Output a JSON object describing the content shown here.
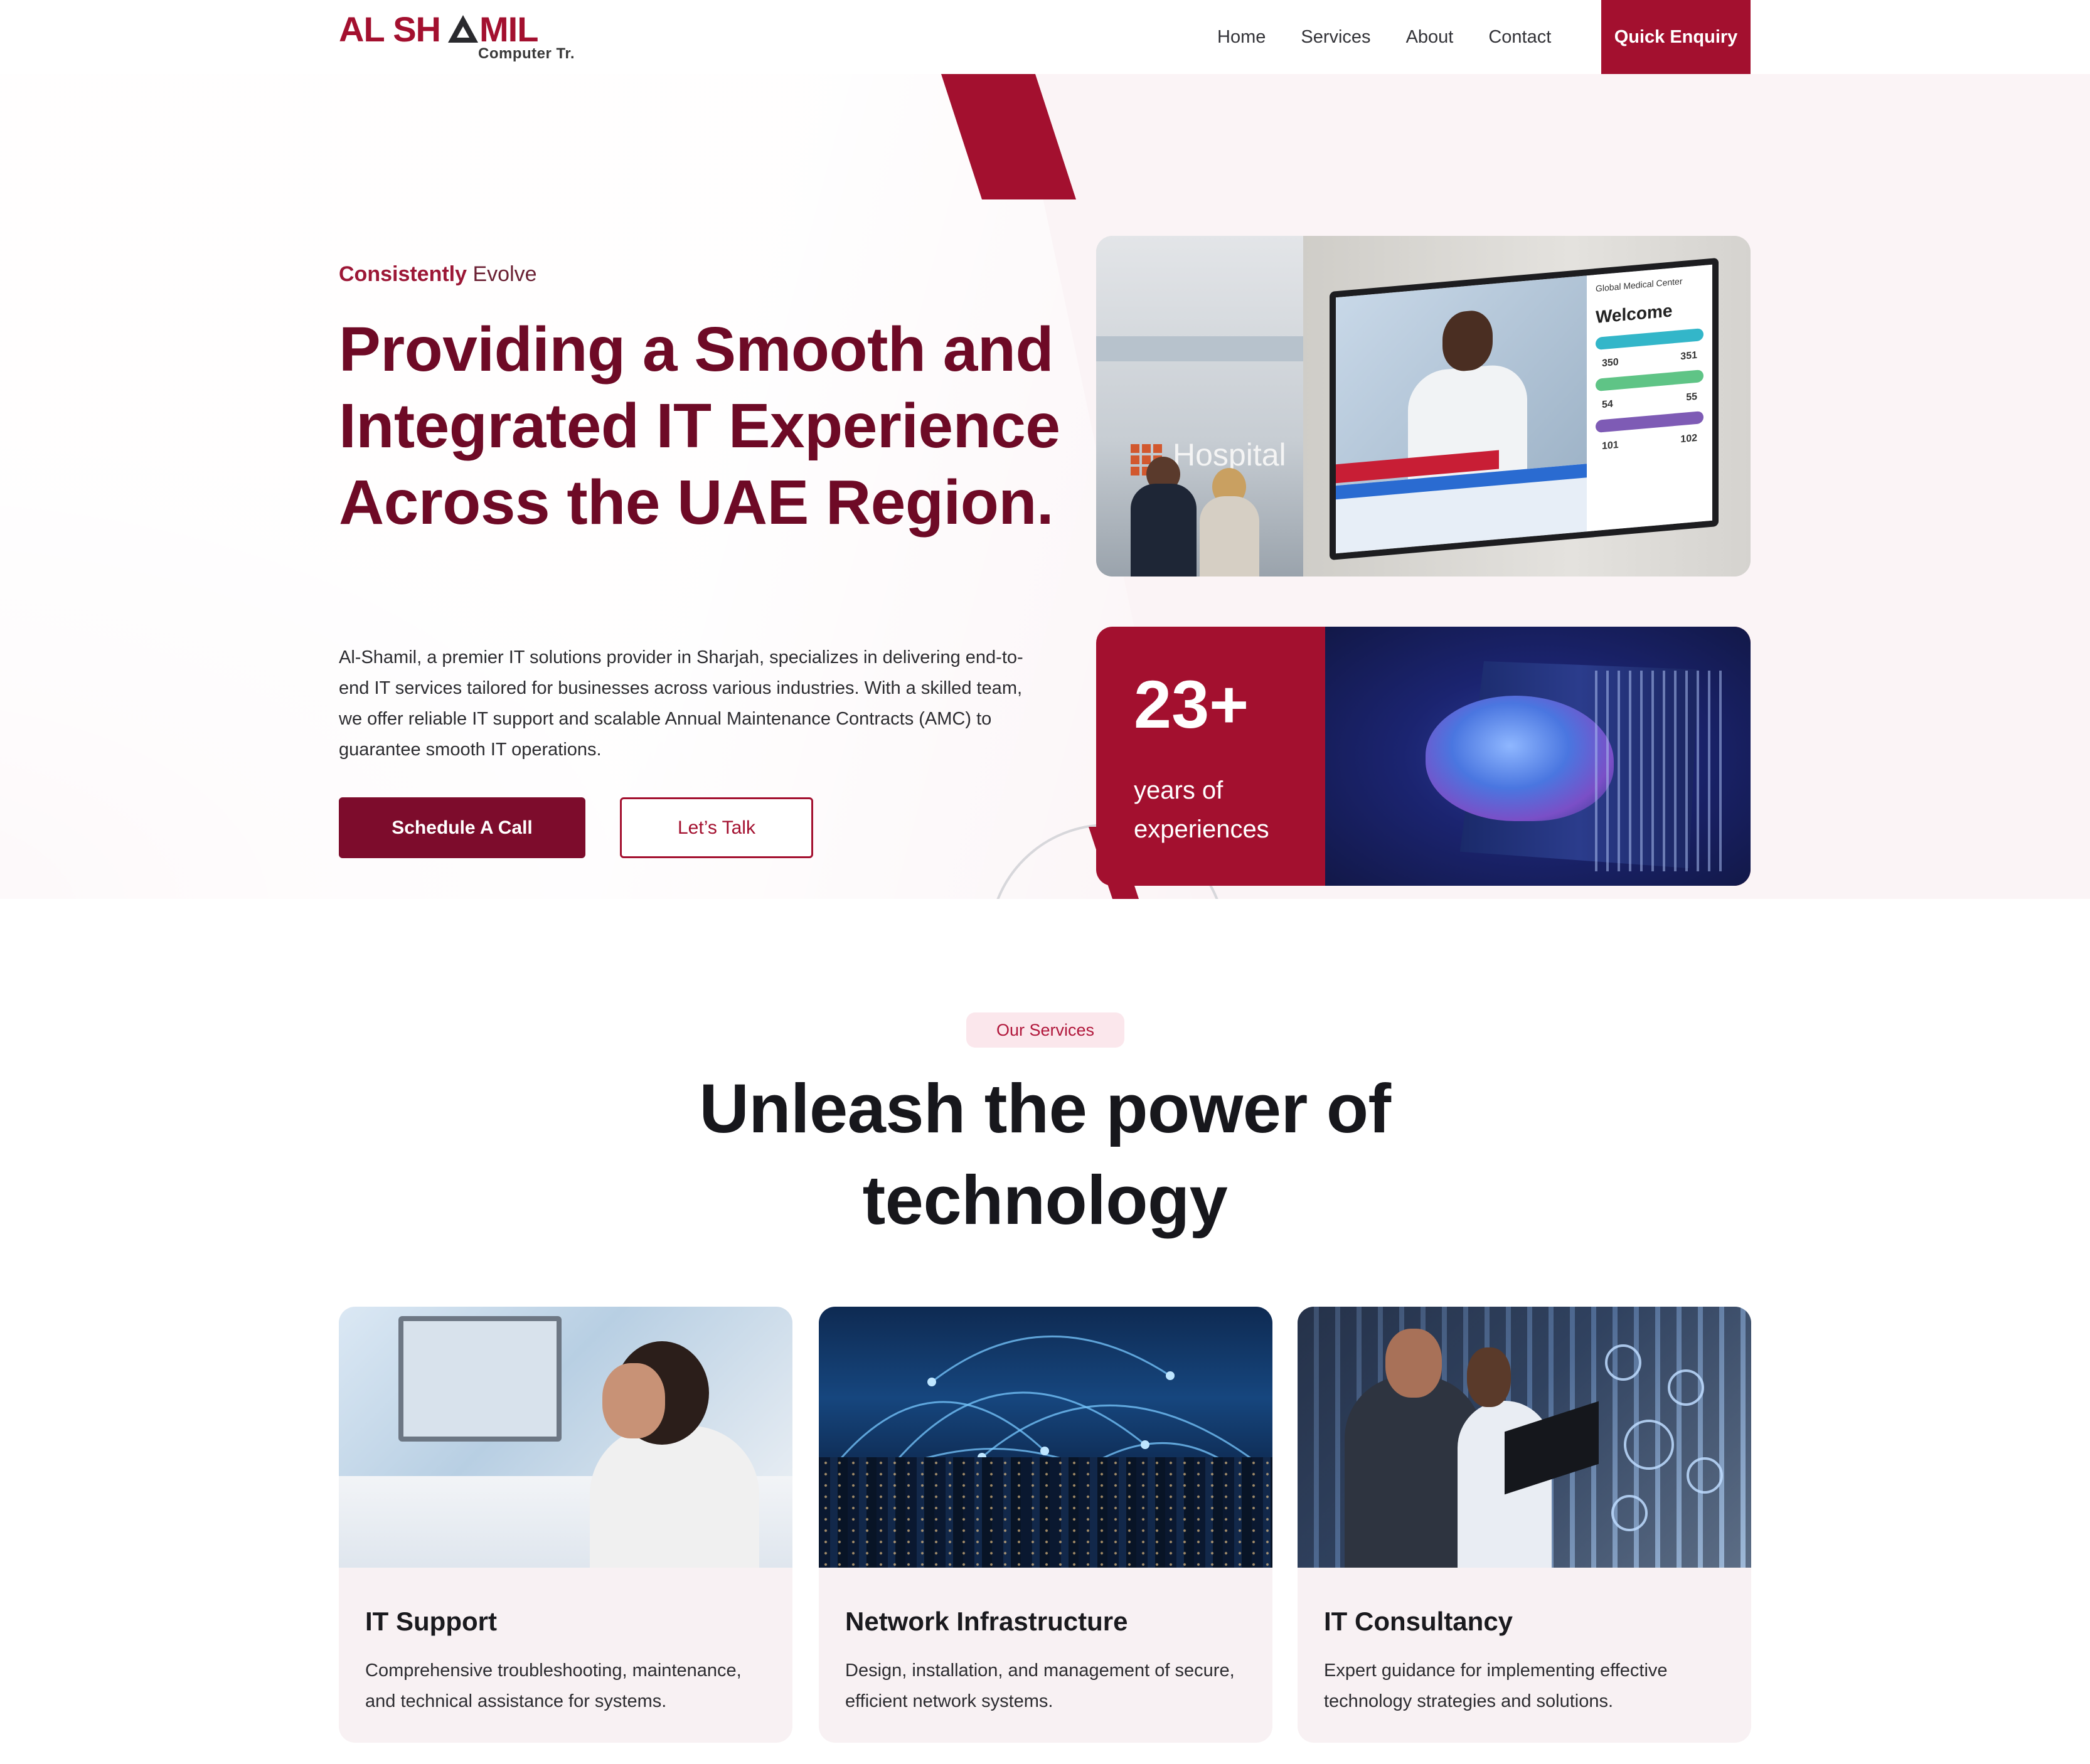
{
  "brand": {
    "name": "AL SHAMIL",
    "sub": "Computer Tr.",
    "color": "#a3102f"
  },
  "nav": {
    "items": [
      "Home",
      "Services",
      "About",
      "Contact"
    ],
    "cta": "Quick Enquiry"
  },
  "hero": {
    "eyebrow_main": "Consistently",
    "eyebrow_sub": "Evolve",
    "title": "Providing a Smooth and Integrated IT Experience Across the UAE Region.",
    "text": "Al-Shamil, a premier IT solutions provider in Sharjah, specializes in delivering end-to-end IT services tailored for businesses across various industries. With a skilled team, we offer reliable IT support and scalable Annual Maintenance Contracts (AMC) to guarantee smooth IT operations.",
    "primary_button": "Schedule A Call",
    "secondary_button": "Let’s Talk",
    "hospital_sign": "Hospital",
    "screen_welcome": "Welcome",
    "screen_header": "Global Medical Center",
    "screen_rooms": [
      {
        "left": "350",
        "right": "351"
      },
      {
        "left": "54",
        "right": "55"
      },
      {
        "left": "101",
        "right": "102"
      }
    ],
    "stat_value": "23+",
    "stat_label": "years of experiences"
  },
  "services": {
    "badge": "Our Services",
    "title": "Unleash the power of technology",
    "cards": [
      {
        "title": "IT Support",
        "text": "Comprehensive troubleshooting, maintenance, and technical assistance for systems."
      },
      {
        "title": "Network Infrastructure",
        "text": "Design, installation, and management of secure, efficient network systems."
      },
      {
        "title": "IT Consultancy",
        "text": "Expert guidance for implementing effective technology strategies and solutions."
      }
    ]
  }
}
